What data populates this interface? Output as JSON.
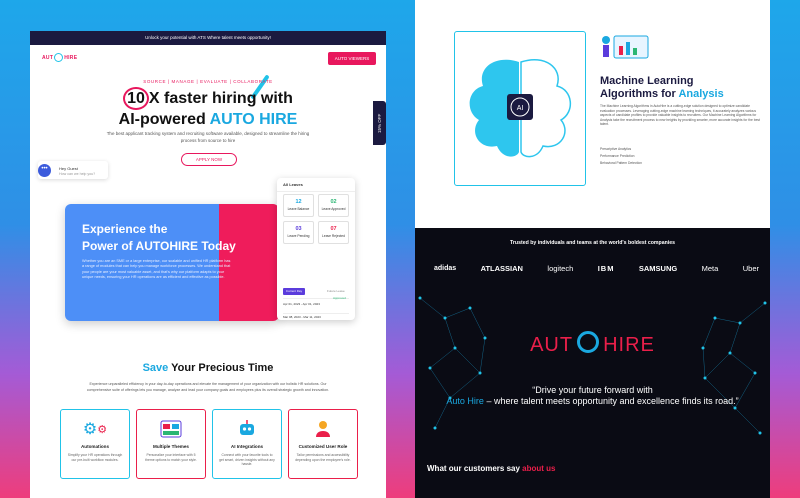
{
  "left": {
    "topbar": "Unlock your potential with ATS Where talent meets opportunity!",
    "logo_left": "AUT",
    "logo_right": "HIRE",
    "nav_button": "AUTO VIEWERS",
    "eyebrow": "SOURCE | MANAGE | EVALUATE | COLLABORATE",
    "headline_num": "10",
    "headline_rest": "X faster hiring with",
    "headline_line2_pre": "AI-powered",
    "headline_accent": "AUTO HIRE",
    "subtitle": "The best applicant tracking system and recruiting software available, designed to streamline the hiring process from source to hire",
    "apply_button": "APPLY NOW",
    "chat_name": "Hey Guest",
    "chat_text": "How can we help you?",
    "side_tab": "15% OFF",
    "experience": {
      "title_line1": "Experience the",
      "title_line2": "Power of AUTOHIRE Today",
      "body": "Whether you are an SME or a large enterprise, our scalable and unified HR platform has a range of modules that can help you manage workforce processes. We understand that your people are your most valuable asset, and that's why our platform adapts to your unique needs, ensuring your HR operations are as efficient and effective as possible."
    },
    "dashboard": {
      "title": "All Leaves",
      "tiles": [
        {
          "num": "12",
          "label": "Leave Balance"
        },
        {
          "num": "02",
          "label": "Leave Approved"
        },
        {
          "num": "03",
          "label": "Leave Pending"
        },
        {
          "num": "07",
          "label": "Leave Rejected"
        }
      ],
      "tab_active": "Current Day",
      "tab2": "Future Leave",
      "rows": [
        {
          "date": "Apr 01, 2023 - Apr 01, 2023",
          "status": "Approved"
        },
        {
          "date": "Mar 08, 2023 - Mar 11, 2023",
          "status": "Approved"
        }
      ]
    },
    "save": {
      "accent": "Save",
      "rest": "Your Precious Time",
      "body": "Experience unparalleled efficiency in your day-to-day operations and elevate the management of your organization with our holistic HR solutions. Our comprehensive suite of offerings lets you manage, analyze and lead your company goals and employees plus its overall strategic growth and innovation."
    },
    "cards": [
      {
        "title": "Automations",
        "desc": "Simplify your HR operations through our pre-built workflow modules.",
        "color": "#21c3e8",
        "icon": "gears-icon"
      },
      {
        "title": "Multiple Themes",
        "desc": "Personalize your interface with 5 theme options to match your style.",
        "color": "#ea1f4a",
        "icon": "themes-icon"
      },
      {
        "title": "AI Integrations",
        "desc": "Connect with your favorite tools to get smart, driven insights without any hassle.",
        "color": "#21c3e8",
        "icon": "robot-icon"
      },
      {
        "title": "Customized User Role",
        "desc": "Tailor permissions and accessibility depending upon the employee's role.",
        "color": "#ea1f4a",
        "icon": "user-role-icon"
      }
    ]
  },
  "right": {
    "ml_title_line1": "Machine Learning",
    "ml_title_pre": "Algorithms for",
    "ml_title_accent": "Analysis",
    "ml_body": "The Machine Learning Algorithms in AutoHire is a cutting-edge solution designed to optimize candidate evaluation processes. Leveraging cutting-edge machine learning techniques, it accurately analyzes various aspects of candidate profiles to provide valuable insights to recruiters. Our Machine Learning Algorithms for Analysis take the recruitment process to new heights by providing smarter, more accurate insights for the best talent.",
    "ml_list": [
      "Prescriptive Analytics",
      "Performance Prediction",
      "Behavioral Pattern Detection"
    ],
    "brain_label": "AI",
    "trusted": "Trusted by individuals and teams at the world's boldest companies",
    "logos": [
      "adidas",
      "ATLASSIAN",
      "logitech",
      "IBM",
      "SAMSUNG",
      "Meta",
      "Uber"
    ],
    "brand_left": "AUT",
    "brand_right": "HIRE",
    "quote_pre": "“Drive your future forward with",
    "quote_accent": "Auto Hire",
    "quote_rest": "– where talent meets opportunity and excellence finds its road.”",
    "customers_pre": "What our customers say",
    "customers_accent": "about us"
  }
}
